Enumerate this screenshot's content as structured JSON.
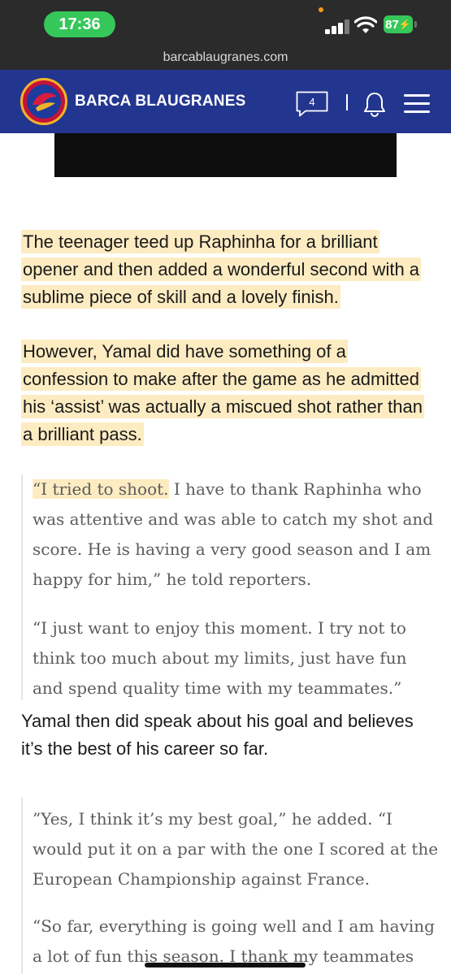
{
  "status_bar": {
    "time": "17:36",
    "battery": "87",
    "colors": {
      "time_pill": "#35c759",
      "battery": "#35c759",
      "bar_bg": "#2b2b2b"
    }
  },
  "browser": {
    "url": "barcablaugranes.com"
  },
  "site_header": {
    "brand": "BARCA BLAUGRANES",
    "comment_count": "4",
    "icons": [
      "logo-icon",
      "comment-icon",
      "bell-icon",
      "menu-icon"
    ],
    "colors": {
      "background": "#23368f"
    }
  },
  "article": {
    "paragraph_1": "The teenager teed up Raphinha for a brilliant opener and then added a wonderful second with a sublime piece of skill and a lovely finish.",
    "paragraph_2": "However, Yamal did have something of a confession to make after the game as he admitted his ‘assist’ was actually a miscued shot rather than a brilliant pass.",
    "quote_1_highlight": "“I tried to shoot.",
    "quote_1_rest": " I have to thank Raphinha who was attentive and was able to catch my shot and score. He is having a very good season and I am happy for him,” he told reporters.",
    "quote_2": "“I just want to enjoy this moment. I try not to think too much about my limits, just have fun and spend quality time with my teammates.”",
    "paragraph_3": "Yamal then did speak about his goal and believes it’s the best of his career so far.",
    "quote_3": "”Yes, I think it’s my best goal,” he added. “I would put it on a par with the one I scored at the European Championship against France.",
    "quote_4": "“So far, everything is going well and I am having a lot of fun this season. I thank my teammates",
    "colors": {
      "highlight": "#fdecc2",
      "quote_text": "#5c5c5c"
    }
  }
}
